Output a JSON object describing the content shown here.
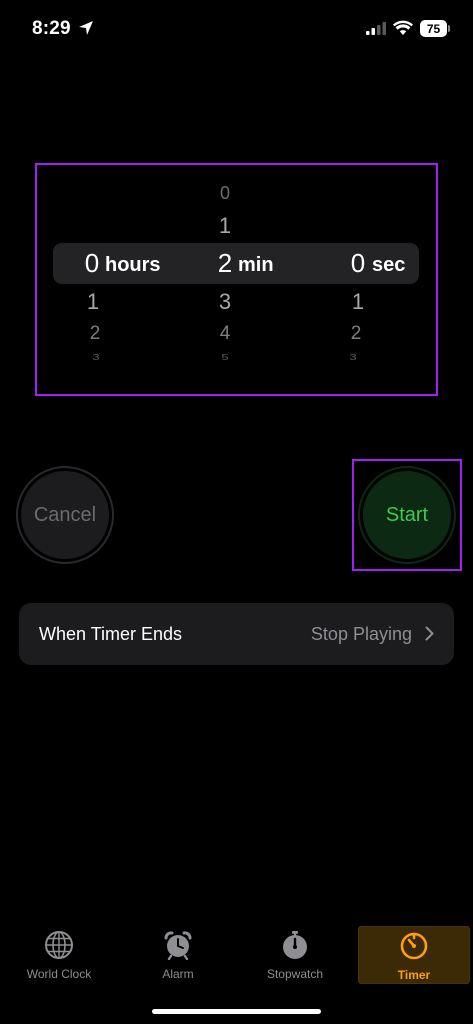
{
  "status_bar": {
    "time": "8:29",
    "battery": "75"
  },
  "picker": {
    "hours": {
      "above": [],
      "selected": "0",
      "below": [
        "1",
        "2",
        "3"
      ],
      "unit": "hours"
    },
    "minutes": {
      "above": [
        "0",
        "1"
      ],
      "selected": "2",
      "below": [
        "3",
        "4",
        "5"
      ],
      "unit": "min"
    },
    "seconds": {
      "above": [],
      "selected": "0",
      "below": [
        "1",
        "2",
        "3"
      ],
      "unit": "sec"
    }
  },
  "buttons": {
    "cancel": "Cancel",
    "start": "Start"
  },
  "timer_end": {
    "label": "When Timer Ends",
    "value": "Stop Playing"
  },
  "tabs": [
    {
      "label": "World Clock",
      "icon": "globe-icon"
    },
    {
      "label": "Alarm",
      "icon": "alarm-clock-icon"
    },
    {
      "label": "Stopwatch",
      "icon": "stopwatch-icon"
    },
    {
      "label": "Timer",
      "icon": "timer-icon",
      "active": true
    }
  ],
  "colors": {
    "accent": "#ff9f0a",
    "start": "#3ec94f",
    "highlight": "#a020f0"
  }
}
